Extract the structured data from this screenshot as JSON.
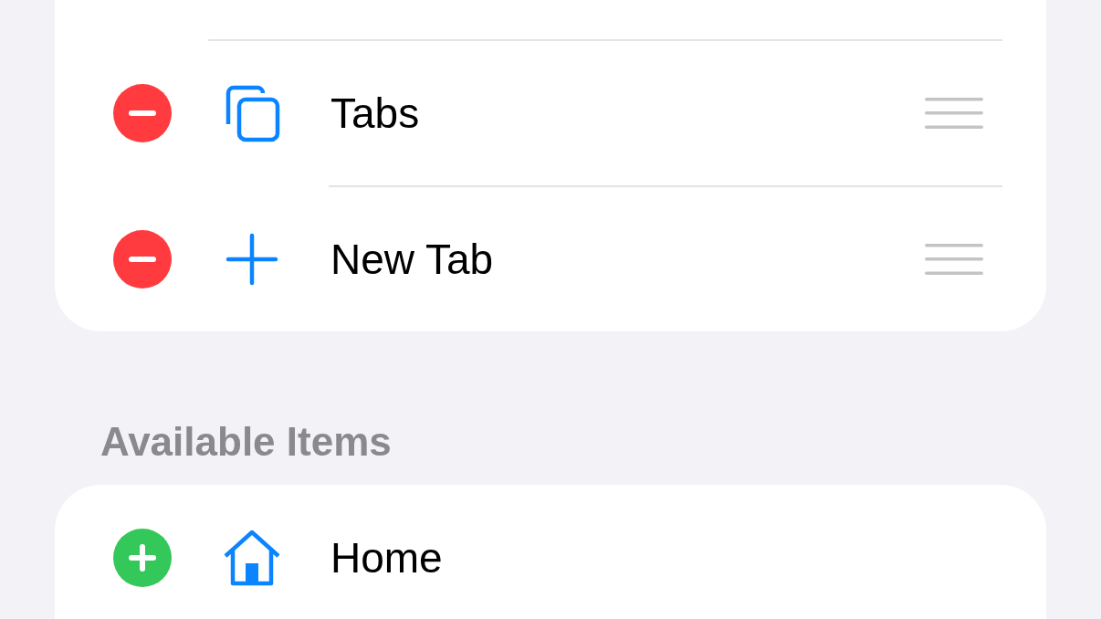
{
  "active_items": [
    {
      "label": "Tabs",
      "kind": "tabs"
    },
    {
      "label": "New Tab",
      "kind": "plus"
    }
  ],
  "available_header": "Available Items",
  "available_items": [
    {
      "label": "Home",
      "kind": "home"
    }
  ]
}
